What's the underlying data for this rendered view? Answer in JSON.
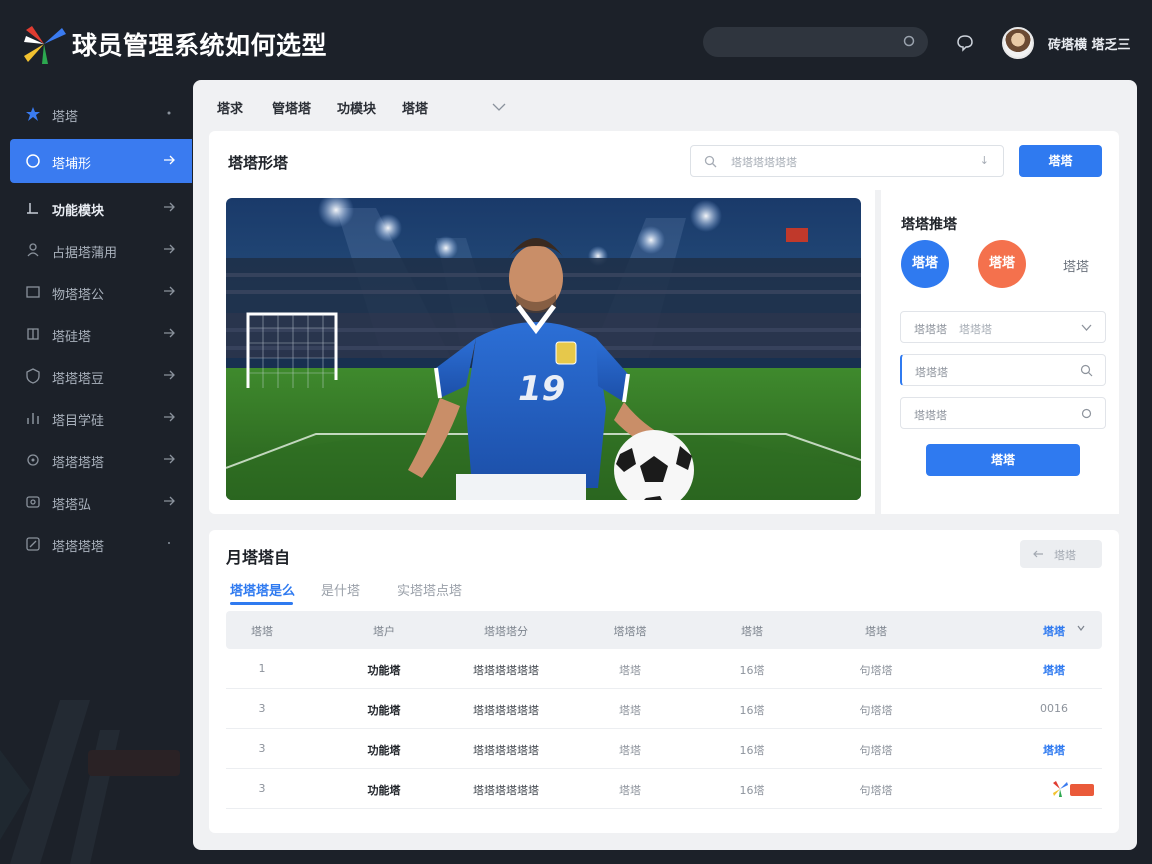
{
  "header": {
    "title": "球员管理系统如何选型",
    "username": "砖塔横 塔乏三",
    "search_icon": "search-icon",
    "message_icon": "chat-icon"
  },
  "sidebar": {
    "items": [
      {
        "label": "塔塔",
        "icon": "star-icon"
      },
      {
        "label": "塔埔形",
        "icon": "chat-bubble-icon",
        "active": true
      },
      {
        "label": "功能模块",
        "icon": "arrow-icon"
      },
      {
        "label": "占据塔蒲用",
        "icon": "user-icon"
      },
      {
        "label": "物塔塔公",
        "icon": "card-icon"
      },
      {
        "label": "塔硅塔",
        "icon": "grid-icon"
      },
      {
        "label": "塔塔塔豆",
        "icon": "shield-icon"
      },
      {
        "label": "塔目学硅",
        "icon": "chart-icon"
      },
      {
        "label": "塔塔塔塔",
        "icon": "settings-icon"
      },
      {
        "label": "塔塔弘",
        "icon": "target-icon"
      },
      {
        "label": "塔塔塔塔",
        "icon": "doc-icon"
      }
    ]
  },
  "main": {
    "tabs": [
      "塔求",
      "管塔塔",
      "功模块",
      "塔塔"
    ],
    "card1": {
      "title": "塔塔形塔",
      "search_placeholder": "塔塔塔塔塔塔",
      "search_suffix": "↓",
      "search_button": "塔塔"
    },
    "side_panel": {
      "title": "塔塔推塔",
      "circle_blue": "塔塔",
      "circle_orange": "塔塔",
      "circle_text": "塔塔",
      "field1_label": "塔塔塔",
      "field1_value": "塔塔塔",
      "field2_label": "塔塔塔",
      "field3_label": "塔塔塔",
      "confirm": "塔塔"
    },
    "card2": {
      "title": "月塔塔自",
      "back_button": "塔塔",
      "subtabs": [
        "塔塔塔是么",
        "是什塔",
        "实塔塔点塔"
      ],
      "columns": [
        "塔塔",
        "塔户",
        "塔塔塔分",
        "塔塔塔",
        "塔塔",
        "塔塔",
        "塔塔"
      ],
      "rows": [
        [
          "1",
          "功能塔",
          "塔塔塔塔塔塔",
          "塔塔",
          "16塔",
          "句塔塔",
          "塔塔"
        ],
        [
          "3",
          "功能塔",
          "塔塔塔塔塔塔",
          "塔塔",
          "16塔",
          "句塔塔",
          "0016"
        ],
        [
          "3",
          "功能塔",
          "塔塔塔塔塔塔",
          "塔塔",
          "16塔",
          "句塔塔",
          "塔塔"
        ],
        [
          "3",
          "功能塔",
          "塔塔塔塔塔塔",
          "塔塔",
          "16塔",
          "句塔塔",
          ""
        ]
      ]
    }
  },
  "colors": {
    "background": "#1c2129",
    "accent": "#2f7af0",
    "orange": "#f4714d",
    "panel": "#f0f1f3"
  }
}
